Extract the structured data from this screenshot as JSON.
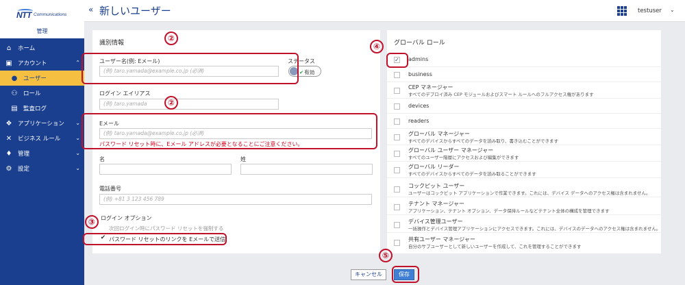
{
  "sidebar": {
    "logo_brand": "NTT",
    "logo_sub": "Communications",
    "admin_label": "管理",
    "items": [
      {
        "label": "ホーム"
      },
      {
        "label": "アカウント"
      },
      {
        "label": "ユーザー"
      },
      {
        "label": "ロール"
      },
      {
        "label": "監査ログ"
      },
      {
        "label": "アプリケーション"
      },
      {
        "label": "ビジネス ルール"
      },
      {
        "label": "管理"
      },
      {
        "label": "設定"
      }
    ]
  },
  "topbar": {
    "collapse": "«",
    "title": "新しいユーザー",
    "user": "testuser"
  },
  "form": {
    "section_title": "識別情報",
    "username_label": "ユーザー名(例: Eメール)",
    "username_placeholder": "(例) taro.yamada@example.co.jp (必須)",
    "status_label": "ステータス",
    "status_value": "有効",
    "alias_label": "ログイン エイリアス",
    "alias_placeholder": "(例) taro.yamada",
    "email_label": "Eメール",
    "email_placeholder": "(例) taro.yamada@example.co.jp (必須)",
    "email_hint": "パスワード リセット時に、Eメール アドレスが必要となることにご注意ください。",
    "first_name_label": "名",
    "last_name_label": "姓",
    "phone_label": "電話番号",
    "phone_placeholder": "(例) +81 3 123 456 789",
    "login_options_label": "ログイン オプション",
    "force_reset_label": "次回ログイン時にパスワード リセットを強制する",
    "send_link_label": "パスワード リセットのリンクを Eメールで送信"
  },
  "roles": {
    "title": "グローバル ロール",
    "items": [
      {
        "name": "admins",
        "desc": "",
        "checked": true
      },
      {
        "name": "business",
        "desc": "",
        "checked": false
      },
      {
        "name": "CEP マネージャー",
        "desc": "すべてのデプロイ済み CEP モジュールおよびスマート ルールへのフルアクセス権があります",
        "checked": false
      },
      {
        "name": "devices",
        "desc": "",
        "checked": false
      },
      {
        "name": "readers",
        "desc": "",
        "checked": false
      },
      {
        "name": "グローバル マネージャー",
        "desc": "すべてのデバイスからすべてのデータを読み取り、書き込むことができます",
        "checked": false
      },
      {
        "name": "グローバル ユーザー マネージャー",
        "desc": "すべてのユーザー階層にアクセスおよび編集ができます",
        "checked": false
      },
      {
        "name": "グローバル リーダー",
        "desc": "すべてのデバイスからすべてのデータを読み取ることができます",
        "checked": false
      },
      {
        "name": "コックピット ユーザー",
        "desc": "ユーザーはコックピット アプリケーションで作業できます。これには、デバイス データへのアクセス権は含まれません。",
        "checked": false
      },
      {
        "name": "テナント マネージャー",
        "desc": "アプリケーション、テナント オプション、データ保持ルールなどテナント全体の構成を管理できます",
        "checked": false
      },
      {
        "name": "デバイス管理ユーザー",
        "desc": "一括操作とデバイス管理アプリケーションにアクセスできます。これには、デバイスのデータへのアクセス権は含まれません。",
        "checked": false
      },
      {
        "name": "共有ユーザー マネージャー",
        "desc": "自分のサブユーザーとして新しいユーザーを作成して、これを管理することができます",
        "checked": false
      }
    ]
  },
  "buttons": {
    "cancel": "キャンセル",
    "save": "保存"
  },
  "annotations": {
    "m1": "②",
    "m2": "②",
    "m3": "③",
    "m4": "④",
    "m5": "⑤"
  }
}
